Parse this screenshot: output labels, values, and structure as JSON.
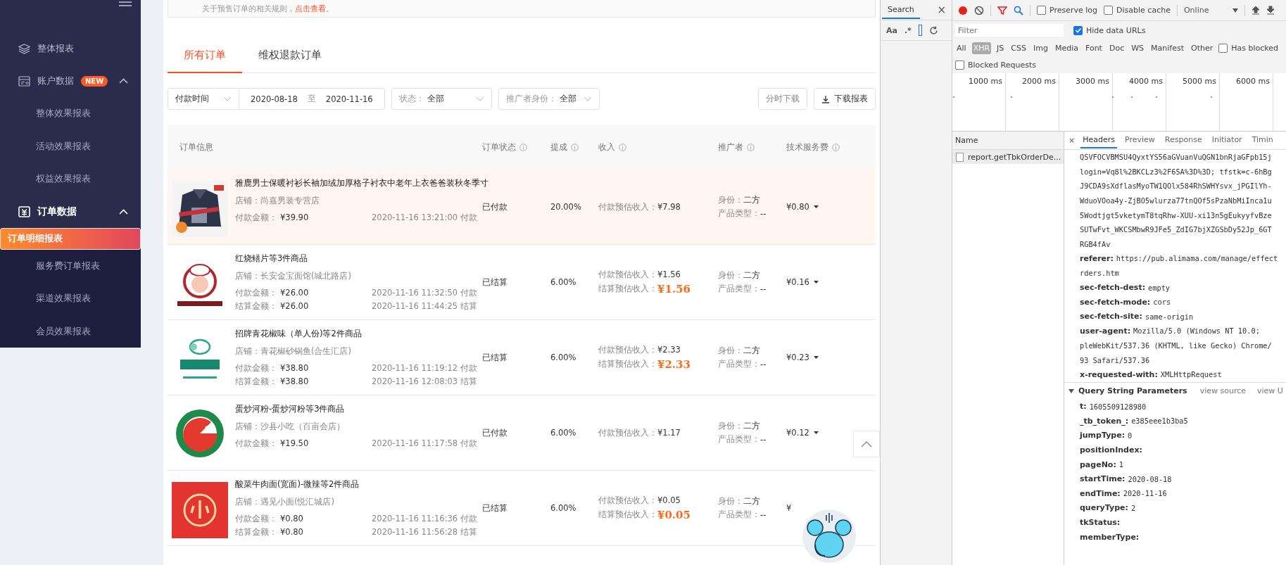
{
  "sidebar": {
    "groups": [
      {
        "label": "整体报表",
        "active": false
      },
      {
        "label": "账户数据",
        "badge": "NEW",
        "expanded": true,
        "active": false,
        "children": [
          {
            "label": "整体效果报表",
            "selected": false
          },
          {
            "label": "活动效果报表",
            "selected": false
          },
          {
            "label": "权益效果报表",
            "selected": false
          }
        ]
      },
      {
        "label": "订单数据",
        "expanded": true,
        "active": true,
        "children": [
          {
            "label": "订单明细报表",
            "selected": true
          },
          {
            "label": "服务费订单报表",
            "selected": false
          },
          {
            "label": "渠道效果报表",
            "selected": false
          },
          {
            "label": "会员效果报表",
            "selected": false
          }
        ]
      }
    ]
  },
  "notice": {
    "text": "关于预售订单的相关规则，",
    "link": "点击查看",
    "end": "。"
  },
  "tabs": [
    {
      "label": "所有订单",
      "selected": true
    },
    {
      "label": "维权退款订单",
      "selected": false
    }
  ],
  "filters": {
    "time_type": "付款时间",
    "start_date": "2020-08-18",
    "separator": "至",
    "end_date": "2020-11-16",
    "selects": [
      {
        "label": "状态：",
        "value": "全部"
      },
      {
        "label": "推广者身份：",
        "value": "全部"
      }
    ],
    "buttons": [
      {
        "label": "分时下载",
        "kind": "plain"
      },
      {
        "label": "下载报表",
        "kind": "download"
      }
    ]
  },
  "table": {
    "columns": [
      {
        "label": "订单信息",
        "info": false
      },
      {
        "label": "订单状态",
        "info": true
      },
      {
        "label": "提成",
        "info": true
      },
      {
        "label": "收入",
        "info": true
      },
      {
        "label": "推广者",
        "info": true
      },
      {
        "label": "技术服务费",
        "info": true
      }
    ],
    "rows": [
      {
        "highlighted": true,
        "title": "雅鹿男士保暖衬衫长袖加绒加厚格子衬衣中老年上衣爸爸装秋冬季寸",
        "shop": "店铺：尚嘉男装专营店",
        "amounts": [
          {
            "label": "付款金额：",
            "amount": "¥39.90",
            "time": "2020-11-16 13:21:00",
            "event": "付款"
          }
        ],
        "status": "已付款",
        "rate": "20.00%",
        "income": [
          {
            "label": "付款预估收入：",
            "value": "¥7.98",
            "emphasis": false
          }
        ],
        "identity_label": "身份：",
        "identity": "二方",
        "product_label": "产品类型：",
        "product": "--",
        "fee": "¥0.80",
        "fee_dropdown": true
      },
      {
        "highlighted": false,
        "title": "红烧鳝片等3件商品",
        "shop": "店铺：长安金宝面馆(城北路店)",
        "amounts": [
          {
            "label": "付款金额：",
            "amount": "¥26.00",
            "time": "2020-11-16 11:32:50",
            "event": "付款"
          },
          {
            "label": "结算金额：",
            "amount": "¥26.00",
            "time": "2020-11-16 11:44:25",
            "event": "结算"
          }
        ],
        "status": "已结算",
        "rate": "6.00%",
        "income": [
          {
            "label": "付款预估收入：",
            "value": "¥1.56",
            "emphasis": false
          },
          {
            "label": "结算预估收入：",
            "value": "¥1.56",
            "emphasis": true
          }
        ],
        "identity_label": "身份：",
        "identity": "二方",
        "product_label": "产品类型：",
        "product": "--",
        "fee": "¥0.16",
        "fee_dropdown": true
      },
      {
        "highlighted": false,
        "title": "招牌青花椒味（单人份)等2件商品",
        "shop": "店铺：青花椒砂锅鱼(合生汇店)",
        "amounts": [
          {
            "label": "付款金额：",
            "amount": "¥38.80",
            "time": "2020-11-16 11:19:12",
            "event": "付款"
          },
          {
            "label": "结算金额：",
            "amount": "¥38.80",
            "time": "2020-11-16 12:08:03",
            "event": "结算"
          }
        ],
        "status": "已结算",
        "rate": "6.00%",
        "income": [
          {
            "label": "付款预估收入：",
            "value": "¥2.33",
            "emphasis": false
          },
          {
            "label": "结算预估收入：",
            "value": "¥2.33",
            "emphasis": true
          }
        ],
        "identity_label": "身份：",
        "identity": "二方",
        "product_label": "产品类型：",
        "product": "--",
        "fee": "¥0.23",
        "fee_dropdown": true
      },
      {
        "highlighted": false,
        "title": "蛋炒河粉-蛋炒河粉等3件商品",
        "shop": "店铺：沙县小吃（百亩会店）",
        "amounts": [
          {
            "label": "付款金额：",
            "amount": "¥19.50",
            "time": "2020-11-16 11:17:58",
            "event": "付款"
          }
        ],
        "status": "已付款",
        "rate": "6.00%",
        "income": [
          {
            "label": "付款预估收入：",
            "value": "¥1.17",
            "emphasis": false
          }
        ],
        "identity_label": "身份：",
        "identity": "二方",
        "product_label": "产品类型：",
        "product": "--",
        "fee": "¥0.12",
        "fee_dropdown": true
      },
      {
        "highlighted": false,
        "title": "酸菜牛肉面(宽面)-微辣等2件商品",
        "shop": "店铺：遇见小面(悦汇城店)",
        "amounts": [
          {
            "label": "付款金额：",
            "amount": "¥0.80",
            "time": "2020-11-16 11:16:36",
            "event": "付款"
          },
          {
            "label": "结算金额：",
            "amount": "¥0.80",
            "time": "2020-11-16 11:56:28",
            "event": "结算"
          }
        ],
        "status": "已结算",
        "rate": "6.00%",
        "income": [
          {
            "label": "付款预估收入：",
            "value": "¥0.05",
            "emphasis": false
          },
          {
            "label": "结算预估收入：",
            "value": "¥0.05",
            "emphasis": true
          }
        ],
        "identity_label": "身份：",
        "identity": "二方",
        "product_label": "产品类型：",
        "product": "--",
        "fee": "¥",
        "fee_dropdown": false
      }
    ]
  },
  "devtools": {
    "search_panel": {
      "tab": "Search",
      "close": "×",
      "options": [
        "Aa",
        ".*"
      ]
    },
    "checkboxes": [
      {
        "label": "Preserve log",
        "checked": false
      },
      {
        "label": "Disable cache",
        "checked": false
      }
    ],
    "throttle": "Online",
    "filter_placeholder": "Filter",
    "hide_data_urls": {
      "label": "Hide data URLs",
      "checked": true
    },
    "types": [
      {
        "label": "All",
        "selected": false
      },
      {
        "label": "XHR",
        "selected": true
      },
      {
        "label": "JS",
        "selected": false
      },
      {
        "label": "CSS",
        "selected": false
      },
      {
        "label": "Img",
        "selected": false
      },
      {
        "label": "Media",
        "selected": false
      },
      {
        "label": "Font",
        "selected": false
      },
      {
        "label": "Doc",
        "selected": false
      },
      {
        "label": "WS",
        "selected": false
      },
      {
        "label": "Manifest",
        "selected": false
      },
      {
        "label": "Other",
        "selected": false
      }
    ],
    "has_blocked": {
      "label": "Has blocked",
      "checked": false
    },
    "blocked_requests": {
      "label": "Blocked Requests",
      "checked": false
    },
    "timeline_ticks": [
      "1000 ms",
      "2000 ms",
      "3000 ms",
      "4000 ms",
      "5000 ms",
      "6000 ms"
    ],
    "name_header": "Name",
    "requests": [
      {
        "name": "report.getTbkOrderDe...",
        "selected": true
      }
    ],
    "detail_close": "×",
    "detail_tabs": [
      {
        "label": "Headers",
        "selected": true
      },
      {
        "label": "Preview",
        "selected": false
      },
      {
        "label": "Response",
        "selected": false
      },
      {
        "label": "Initiator",
        "selected": false
      },
      {
        "label": "Timin",
        "selected": false
      }
    ],
    "headers": [
      {
        "value": "QSVFOCVBMSU4QyxtYS56aGVuanVuQGN1bnRjaGFpb15j"
      },
      {
        "value": "login=Vq8l%2BKCLz3%2F65A%3D%3D; tfstk=c-6hBg"
      },
      {
        "value": "J9CDA9sXdflasMyoTW1QOlx584RhSWHYsvx_jPGIlYh-"
      },
      {
        "value": "WduoVOoa4y-ZjBO5wlurza77tnQOf5sPzaNbMiInca1u"
      },
      {
        "value": "5Wodtjgt5vketymT8tqRhw-XUU-xi13n5gEukyyfvBze"
      },
      {
        "value": "SUTwFvt_WKCSMbwR9JFe5_ZdIG7bjXZGSbDy52Jp_6GT"
      },
      {
        "value": "RGB4fAv"
      },
      {
        "key": "referer:",
        "value": "https://pub.alimama.com/manage/effect"
      },
      {
        "value": "rders.htm"
      },
      {
        "key": "sec-fetch-dest:",
        "value": "empty"
      },
      {
        "key": "sec-fetch-mode:",
        "value": "cors"
      },
      {
        "key": "sec-fetch-site:",
        "value": "same-origin"
      },
      {
        "key": "user-agent:",
        "value": "Mozilla/5.0 (Windows NT 10.0;"
      },
      {
        "value": "pleWebKit/537.36 (KHTML, like Gecko) Chrome/"
      },
      {
        "value": "93 Safari/537.36"
      },
      {
        "key": "x-requested-with:",
        "value": "XMLHttpRequest"
      }
    ],
    "query_section": {
      "title": "Query String Parameters",
      "expanded": true,
      "links": [
        "view source",
        "view U"
      ]
    },
    "params": [
      {
        "key": "t:",
        "value": "1605509128980"
      },
      {
        "key": "_tb_token_:",
        "value": "e385eee1b3ba5"
      },
      {
        "key": "jumpType:",
        "value": "0"
      },
      {
        "key": "positionIndex:"
      },
      {
        "key": "pageNo:",
        "value": "1"
      },
      {
        "key": "startTime:",
        "value": "2020-08-18"
      },
      {
        "key": "endTime:",
        "value": "2020-11-16"
      },
      {
        "key": "queryType:",
        "value": "2"
      },
      {
        "key": "tkStatus:"
      },
      {
        "key": "memberType:"
      }
    ]
  }
}
